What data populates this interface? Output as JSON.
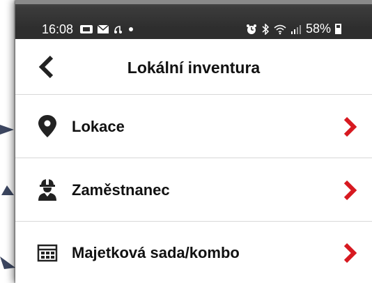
{
  "status_bar": {
    "time": "16:08",
    "battery": "58%",
    "icons_left": [
      "screen-mirror-icon",
      "message-icon",
      "bluetooth-audio-icon",
      "dot-icon"
    ],
    "icons_right": [
      "alarm-icon",
      "bluetooth-icon",
      "wifi-icon",
      "signal-icon",
      "battery-icon"
    ]
  },
  "header": {
    "title": "Lokální inventura",
    "back_icon": "chevron-left-icon"
  },
  "menu": {
    "items": [
      {
        "label": "Lokace",
        "icon": "location-pin-icon"
      },
      {
        "label": "Zaměstnanec",
        "icon": "worker-icon"
      },
      {
        "label": "Majetková sada/kombo",
        "icon": "asset-set-icon"
      }
    ],
    "chevron_icon": "chevron-right-icon",
    "accent_color": "#d71920"
  }
}
